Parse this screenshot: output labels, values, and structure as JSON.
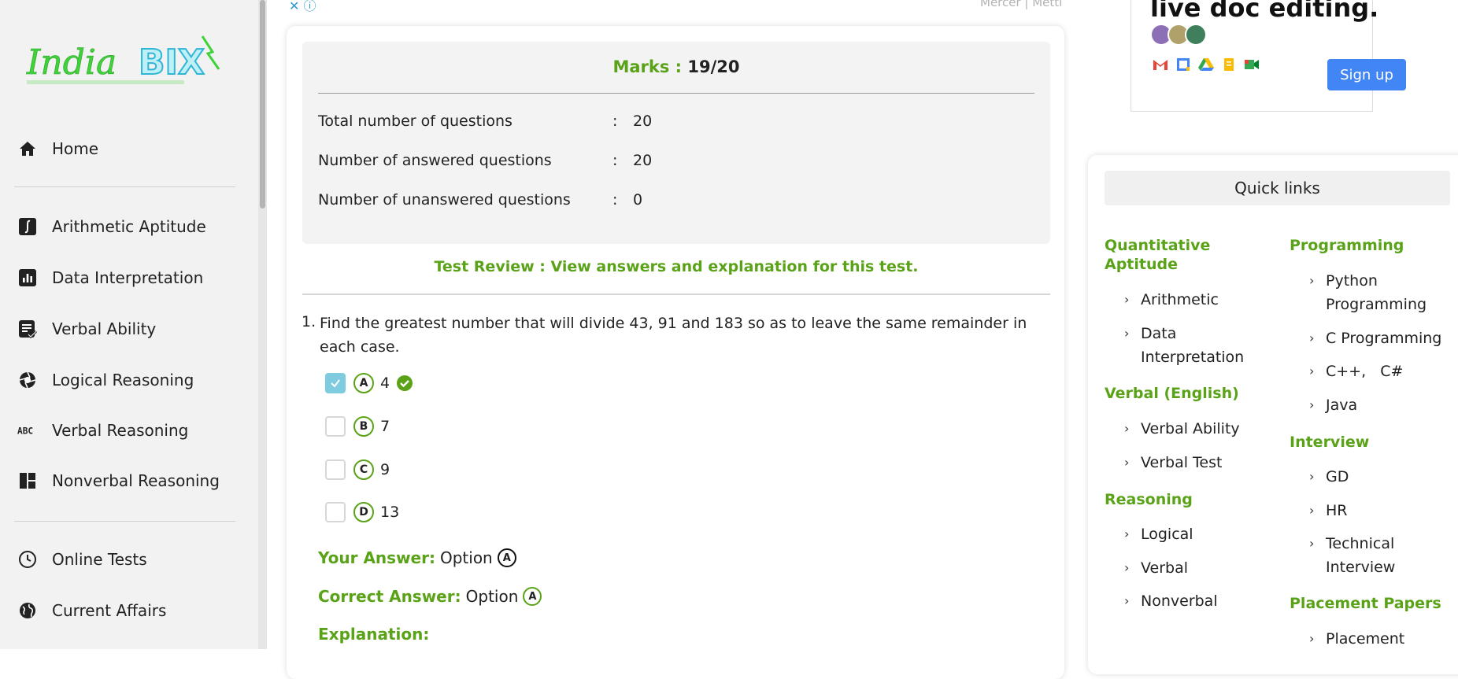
{
  "logo": {
    "text_part1": "India",
    "text_part2": "BIX"
  },
  "sidebar": {
    "items": [
      {
        "label": "Home",
        "icon": "home-icon"
      },
      {
        "label": "Arithmetic Aptitude",
        "icon": "integral-icon"
      },
      {
        "label": "Data Interpretation",
        "icon": "bar-chart-icon"
      },
      {
        "label": "Verbal Ability",
        "icon": "note-check-icon"
      },
      {
        "label": "Logical Reasoning",
        "icon": "aperture-icon"
      },
      {
        "label": "Verbal Reasoning",
        "icon": "abc-icon"
      },
      {
        "label": "Nonverbal Reasoning",
        "icon": "dashboard-icon"
      },
      {
        "label": "Online Tests",
        "icon": "clock-icon"
      },
      {
        "label": "Current Affairs",
        "icon": "globe-icon"
      }
    ]
  },
  "ads": {
    "top_left": "✕ ⓘ",
    "top_right": "Mercer | Mettl",
    "right": {
      "title": "live doc editing.",
      "signup": "Sign up"
    }
  },
  "summary": {
    "marks_label": "Marks :",
    "marks_value": "19/20",
    "rows": [
      {
        "label": "Total number of questions",
        "sep": ":",
        "value": "20"
      },
      {
        "label": "Number of answered questions",
        "sep": ":",
        "value": "20"
      },
      {
        "label": "Number of unanswered questions",
        "sep": ":",
        "value": "0"
      }
    ]
  },
  "review_link": "Test Review : View answers and explanation for this test.",
  "question": {
    "number": "1.",
    "text": "Find the greatest number that will divide 43, 91 and 183 so as to leave the same remainder in each case.",
    "options": [
      {
        "letter": "A",
        "value": "4",
        "checked": true,
        "correct": true
      },
      {
        "letter": "B",
        "value": "7",
        "checked": false,
        "correct": false
      },
      {
        "letter": "C",
        "value": "9",
        "checked": false,
        "correct": false
      },
      {
        "letter": "D",
        "value": "13",
        "checked": false,
        "correct": false
      }
    ],
    "your_answer_label": "Your Answer:",
    "your_answer_text": "Option",
    "your_answer_letter": "A",
    "correct_answer_label": "Correct Answer:",
    "correct_answer_text": "Option",
    "correct_answer_letter": "A",
    "explanation_label": "Explanation:"
  },
  "quick_links": {
    "title": "Quick links",
    "left": {
      "quantitative": {
        "title": "Quantitative Aptitude",
        "items": [
          "Arithmetic",
          "Data Interpretation"
        ]
      },
      "verbal": {
        "title": "Verbal (English)",
        "items": [
          "Verbal Ability",
          "Verbal Test"
        ]
      },
      "reasoning": {
        "title": "Reasoning",
        "items": [
          "Logical",
          "Verbal",
          "Nonverbal"
        ]
      }
    },
    "right": {
      "programming": {
        "title": "Programming",
        "items": [
          "Python Programming",
          "C Programming",
          "C++,   C#",
          "Java"
        ]
      },
      "interview": {
        "title": "Interview",
        "items": [
          "GD",
          "HR",
          "Technical Interview"
        ]
      },
      "placement": {
        "title": "Placement Papers",
        "items": [
          "Placement"
        ]
      }
    }
  },
  "colors": {
    "accent_green": "#5aa318",
    "checkbox_blue": "#7fcbe0",
    "signup_blue": "#4285f4"
  }
}
